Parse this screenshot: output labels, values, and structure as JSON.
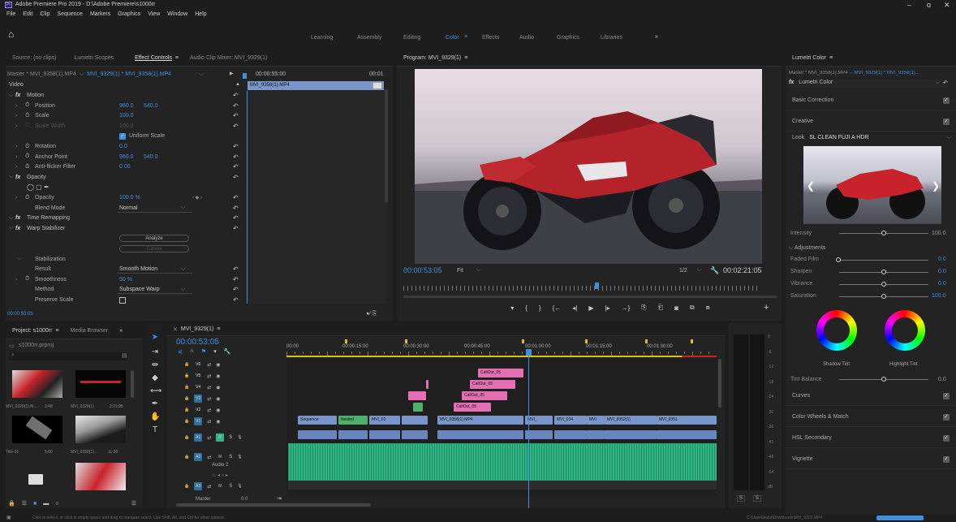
{
  "window": {
    "title": "Adobe Premiere Pro 2019 - D:\\Adobe Premiere\\s1000rr",
    "controls": [
      "–",
      "ɑ",
      "✕"
    ]
  },
  "menu": [
    "File",
    "Edit",
    "Clip",
    "Sequence",
    "Markers",
    "Graphics",
    "View",
    "Window",
    "Help"
  ],
  "workspaces": [
    "Learning",
    "Assembly",
    "Editing",
    "Color",
    "Effects",
    "Audio",
    "Graphics",
    "Libraries"
  ],
  "active_workspace": "Color",
  "source_panel": {
    "tabs": [
      "Source: (no clips)",
      "Lumetri Scopes",
      "Effect Controls",
      "Audio Clip Mixer: MVI_9329(1)"
    ],
    "master": "Master * MVI_9358(1).MP4",
    "clip_link": "MVI_9329(1) * MVI_9358(1).MP4",
    "timecode": "00:00:55:00",
    "timecode2": "00:01",
    "clip_bar": "MVI_9358(1).MP4",
    "section": "Video",
    "footer_tc": "00:00:53:05",
    "rows": [
      {
        "label": "Motion",
        "value": "",
        "value2": "",
        "kind": "fx"
      },
      {
        "label": "Position",
        "value": "960.0",
        "value2": "540.0",
        "kind": "prop"
      },
      {
        "label": "Scale",
        "value": "100.0",
        "value2": "",
        "kind": "prop"
      },
      {
        "label": "Scale Width",
        "value": "100.0",
        "value2": "",
        "kind": "dim"
      },
      {
        "label": "",
        "value": "Uniform Scale",
        "value2": "",
        "kind": "check"
      },
      {
        "label": "Rotation",
        "value": "0.0",
        "value2": "",
        "kind": "prop"
      },
      {
        "label": "Anchor Point",
        "value": "960.0",
        "value2": "540.0",
        "kind": "prop"
      },
      {
        "label": "Anti-flicker Filter",
        "value": "0.00",
        "value2": "",
        "kind": "prop"
      },
      {
        "label": "Opacity",
        "value": "",
        "value2": "",
        "kind": "fx"
      },
      {
        "label": "",
        "value": "",
        "value2": "",
        "kind": "shapes"
      },
      {
        "label": "Opacity",
        "value": "100.0 %",
        "value2": "",
        "kind": "prop"
      },
      {
        "label": "Blend Mode",
        "value": "Normal",
        "value2": "",
        "kind": "select"
      },
      {
        "label": "Time Remapping",
        "value": "",
        "value2": "",
        "kind": "fx"
      },
      {
        "label": "Warp Stabilizer",
        "value": "",
        "value2": "",
        "kind": "fx"
      },
      {
        "label": "",
        "value": "Analyze",
        "value2": "",
        "kind": "button"
      },
      {
        "label": "",
        "value": "Cancel",
        "value2": "",
        "kind": "button-dim"
      },
      {
        "label": "Stabilization",
        "value": "",
        "value2": "",
        "kind": "sub"
      },
      {
        "label": "Result",
        "value": "Smooth Motion",
        "value2": "",
        "kind": "select"
      },
      {
        "label": "Smoothness",
        "value": "50 %",
        "value2": "",
        "kind": "prop"
      },
      {
        "label": "Method",
        "value": "Subspace Warp",
        "value2": "",
        "kind": "select"
      },
      {
        "label": "Preserve Scale",
        "value": "",
        "value2": "",
        "kind": "box"
      }
    ]
  },
  "program": {
    "title": "Program: MVI_9329(1)",
    "timecode": "00:00:53:05",
    "fit": "Fit",
    "quality": "1/2",
    "duration": "00:02:21:05",
    "transport": [
      "▾",
      "{",
      "}",
      "{←",
      "◂|",
      "▶",
      "|▸",
      "→}",
      "⎘",
      "⎗",
      "◙",
      "⧉",
      "⧈"
    ],
    "add": "+"
  },
  "lumetri": {
    "title": "Lumetri Color",
    "master": "Master * MVI_9358(1).MP4",
    "link": "MVI_9329(1) * MVI_9358(1)...",
    "fx": "Lumetri Color",
    "sections": [
      "Basic Correction",
      "Creative"
    ],
    "look_label": "Look",
    "look_value": "SL CLEAN FUJI A HDR",
    "intensity_label": "Intensity",
    "intensity_value": "100.0",
    "adjustments": "Adjustments",
    "sliders": [
      {
        "label": "Faded Film",
        "value": "0.0"
      },
      {
        "label": "Sharpen",
        "value": "0.0"
      },
      {
        "label": "Vibrance",
        "value": "0.0"
      },
      {
        "label": "Saturation",
        "value": "100.0"
      }
    ],
    "shadow_tint": "Shadow Tint",
    "highlight_tint": "Highlight Tint",
    "tint_balance": "Tint Balance",
    "tint_balance_value": "0.0",
    "more_sections": [
      "Curves",
      "Color Wheels & Match",
      "HSL Secondary",
      "Vignette"
    ]
  },
  "project": {
    "tabs": [
      "Project: s1000rr",
      "Media Browser"
    ],
    "file": "s1000rr.prproj",
    "items": [
      {
        "name": "MVI_9329(1).M...",
        "dur": "3:48"
      },
      {
        "name": "MVI_9329(1)",
        "dur": "2:21:05"
      },
      {
        "name": "Title 01",
        "dur": "5:00"
      },
      {
        "name": "MVI_9358(1)...",
        "dur": "11:38"
      }
    ]
  },
  "timeline": {
    "title": "MVI_9329(1)",
    "timecode": "00:00:53:05",
    "ruler": [
      "00:00",
      "00:00:15:00",
      "00:00:30:00",
      "00:00:45:00",
      "00:01:00:00",
      "00:01:15:00",
      "00:01:30:00"
    ],
    "tracks": [
      "V6",
      "V5",
      "V4",
      "V3",
      "V2",
      "V1",
      "A1",
      "A2",
      "A3"
    ],
    "audio2_label": "Audio 2",
    "master_label": "Master",
    "master_value": "0.0",
    "callouts": [
      "CallOut_05",
      "CallOut_05",
      "CallOut_05",
      "CallOut_05"
    ],
    "v1_clips": [
      "Sequence",
      "Nested",
      "MVI_03",
      "",
      "MVI_9358(1).MP4",
      "MVI_",
      "MVI_034",
      "MVI",
      "MVI_9352(1)",
      "MVI_9351"
    ]
  },
  "meter_scale": [
    "0",
    "-6",
    "-12",
    "-18",
    "-24",
    "-30",
    "-36",
    "-42",
    "-48",
    "-54",
    "dB"
  ],
  "meter_buttons": [
    "S",
    "S"
  ],
  "status": {
    "hint": "Click to select, or click in empty space and drag to marquee select. Use Shift, Alt, and Ctrl for other options.",
    "path": "C:\\Users\\kulia\\Downloads\\MVI_9322.MP4"
  },
  "colors": {
    "accent": "#3d8fe0",
    "clip_blue": "#7a95c9",
    "clip_pink": "#e46fb4",
    "clip_green": "#4caf6a",
    "audio_green": "#2fb586",
    "bike_red": "#b4232a"
  }
}
